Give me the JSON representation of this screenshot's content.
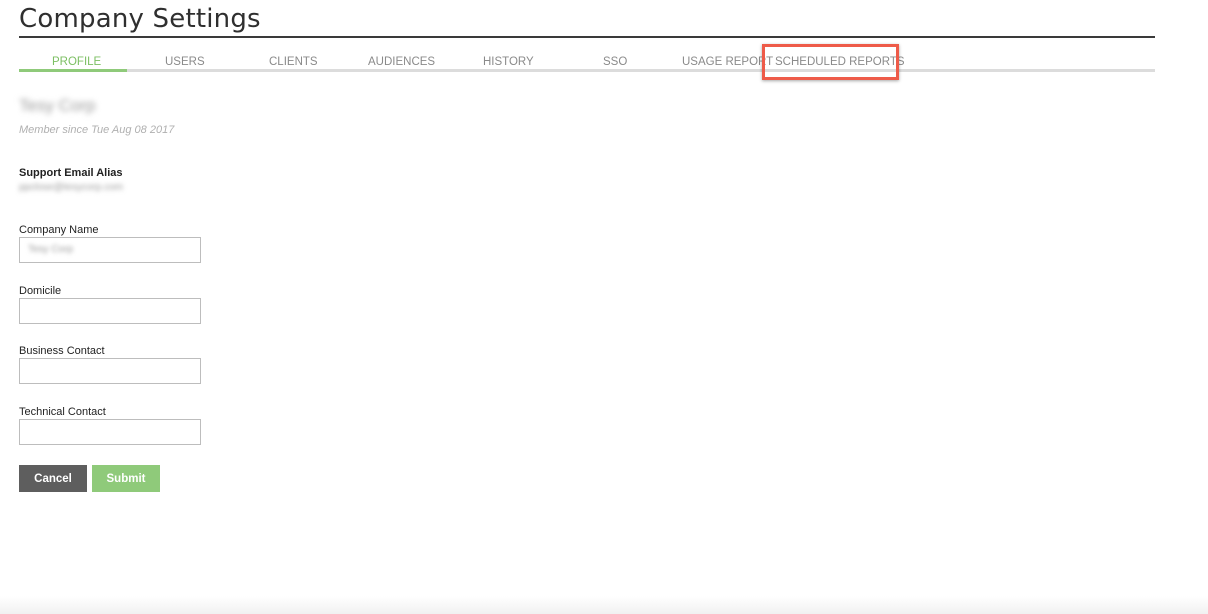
{
  "page": {
    "title": "Company Settings"
  },
  "tabs": [
    {
      "label": "PROFILE",
      "active": true
    },
    {
      "label": "USERS",
      "active": false
    },
    {
      "label": "CLIENTS",
      "active": false
    },
    {
      "label": "AUDIENCES",
      "active": false
    },
    {
      "label": "HISTORY",
      "active": false
    },
    {
      "label": "SSO",
      "active": false
    },
    {
      "label": "USAGE REPORT",
      "active": false
    },
    {
      "label": "SCHEDULED REPORTS",
      "active": false,
      "highlighted": true
    }
  ],
  "profile": {
    "org_name": "Tesy Corp",
    "member_since": "Member since Tue Aug 08 2017"
  },
  "support": {
    "label": "Support Email Alias",
    "value": "ppclose@tesycorp.com"
  },
  "form": {
    "company_name": {
      "label": "Company Name",
      "value": "Tesy Corp"
    },
    "domicile": {
      "label": "Domicile",
      "value": ""
    },
    "business_contact": {
      "label": "Business Contact",
      "value": ""
    },
    "technical_contact": {
      "label": "Technical Contact",
      "value": ""
    }
  },
  "buttons": {
    "cancel": "Cancel",
    "submit": "Submit"
  },
  "colors": {
    "accent": "#8fca7a",
    "active_tab_text": "#7cbf63",
    "highlight_border": "#ee5b49",
    "cancel_bg": "#5e5e5e"
  }
}
